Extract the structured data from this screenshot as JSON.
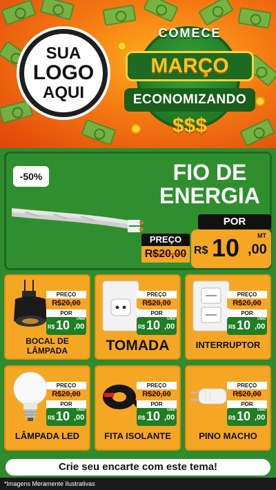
{
  "logo": {
    "line1": "SUA",
    "line2": "LOGO",
    "line3": "AQUI"
  },
  "campaign": {
    "top": "COMECE",
    "month": "MARÇO",
    "bottom": "ECONOMIZANDO",
    "symbols": "$$$"
  },
  "featured": {
    "discount": "-50%",
    "title_line1": "FIO DE",
    "title_line2": "ENERGIA",
    "por_label": "POR",
    "preco_label": "PREÇO",
    "old_price": "R$20,00",
    "currency": "R$",
    "price_int": "10",
    "price_dec": ",00",
    "unit": "MT"
  },
  "products": [
    {
      "name": "BOCAL DE LÂMPADA",
      "preco_label": "PREÇO",
      "old_price": "R$20,00",
      "por_label": "POR",
      "currency": "R$",
      "price_int": "10",
      "price_dec": ",00",
      "unit": "UNID",
      "icon": "lamp-socket-icon"
    },
    {
      "name": "TOMADA",
      "preco_label": "PREÇO",
      "old_price": "R$20,00",
      "por_label": "POR",
      "currency": "R$",
      "price_int": "10",
      "price_dec": ",00",
      "unit": "UNID",
      "icon": "wall-outlet-icon"
    },
    {
      "name": "INTERRUPTOR",
      "preco_label": "PREÇO",
      "old_price": "R$20,00",
      "por_label": "POR",
      "currency": "R$",
      "price_int": "10",
      "price_dec": ",00",
      "unit": "UNID",
      "icon": "light-switch-icon"
    },
    {
      "name": "LÂMPADA LED",
      "preco_label": "PREÇO",
      "old_price": "R$20,00",
      "por_label": "POR",
      "currency": "R$",
      "price_int": "10",
      "price_dec": ",00",
      "unit": "UNID",
      "icon": "led-bulb-icon"
    },
    {
      "name": "FITA ISOLANTE",
      "preco_label": "PREÇO",
      "old_price": "R$20,00",
      "por_label": "POR",
      "currency": "R$",
      "price_int": "10",
      "price_dec": ",00",
      "unit": "UNID",
      "icon": "insulating-tape-icon"
    },
    {
      "name": "PINO MACHO",
      "preco_label": "PREÇO",
      "old_price": "R$20,00",
      "por_label": "POR",
      "currency": "R$",
      "price_int": "10",
      "price_dec": ",00",
      "unit": "UNID",
      "icon": "male-plug-icon"
    }
  ],
  "footer": {
    "banner": "Crie seu encarte com este tema!",
    "disclaimer": "*Imagens Meramente Ilustrativas"
  },
  "colors": {
    "green": "#2f8f2f",
    "orange": "#f5a623",
    "dark_green": "#1e7f25",
    "header_orange": "#f57a12"
  }
}
